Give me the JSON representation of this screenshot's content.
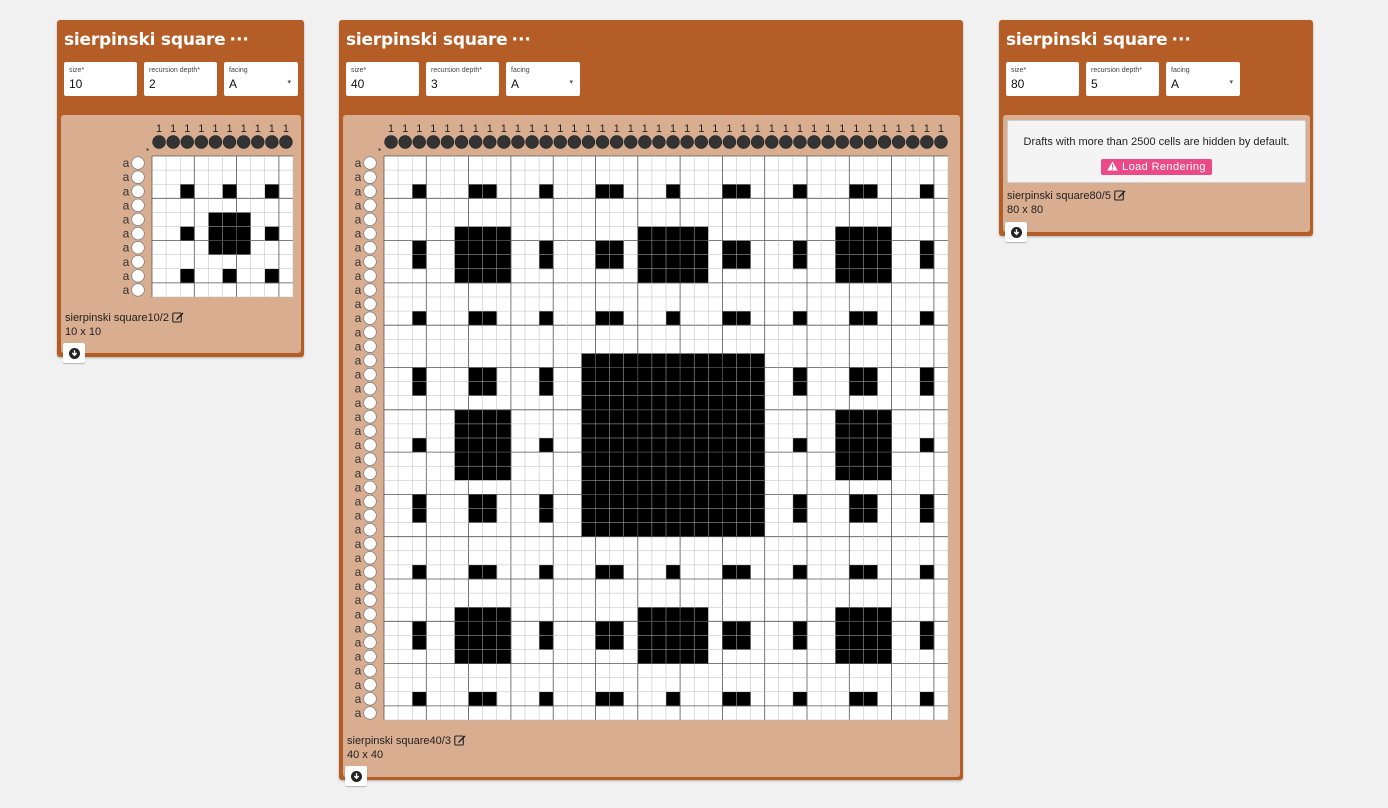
{
  "operations": [
    {
      "title": "sierpinski square",
      "menu": "···",
      "fields": [
        {
          "label": "size*",
          "value": "10"
        },
        {
          "label": "recursion depth*",
          "value": "2"
        },
        {
          "label": "facing",
          "value": "A",
          "select": true
        }
      ],
      "draft": {
        "warp_label": "1",
        "weft_label": "a",
        "size": 10,
        "depth": 2
      },
      "caption": "sierpinski square10/2",
      "dims": "10 x 10"
    },
    {
      "title": "sierpinski square",
      "menu": "···",
      "fields": [
        {
          "label": "size*",
          "value": "40"
        },
        {
          "label": "recursion depth*",
          "value": "3"
        },
        {
          "label": "facing",
          "value": "A",
          "select": true
        }
      ],
      "draft": {
        "warp_label": "1",
        "weft_label": "a",
        "size": 40,
        "depth": 3
      },
      "caption": "sierpinski square40/3",
      "dims": "40 x 40"
    },
    {
      "title": "sierpinski square",
      "menu": "···",
      "fields": [
        {
          "label": "size*",
          "value": "80"
        },
        {
          "label": "recursion depth*",
          "value": "5"
        },
        {
          "label": "facing",
          "value": "A",
          "select": true
        }
      ],
      "notice": {
        "message": "Drafts with more than 2500 cells are hidden by default.",
        "button": "Load Rendering"
      },
      "caption": "sierpinski square80/5",
      "dims": "80 x 80"
    }
  ],
  "colors": {
    "operation": "#b55d27",
    "panel": "#d9ad90",
    "load_button": "#ec4a86",
    "cell_on": "#000000",
    "cell_off": "#ffffff"
  },
  "icons": {
    "menu": "ellipsis-icon",
    "edit": "edit-icon",
    "download": "download-icon",
    "warning": "warning-icon"
  }
}
